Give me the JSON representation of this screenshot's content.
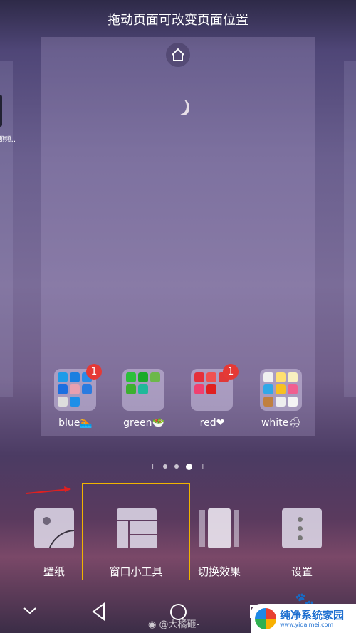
{
  "header": {
    "title": "拖动页面可改变页面位置"
  },
  "left_page": {
    "app_label": "视频.."
  },
  "folders": [
    {
      "label": "blue🏊",
      "badge": "1",
      "colors": [
        "#1e9be8",
        "#1a7fe0",
        "#2b8be8",
        "#1b6fe0",
        "#e8a0b0",
        "#2a7be0",
        "#ddd",
        "#1d8fe8"
      ]
    },
    {
      "label": "green🥗",
      "badge": "",
      "colors": [
        "#2bbf3a",
        "#1aaa2a",
        "#6cb84a",
        "#3cb030",
        "#1fb89a"
      ]
    },
    {
      "label": "red❤",
      "badge": "1",
      "colors": [
        "#e5303a",
        "#f05050",
        "#e03838",
        "#f04070",
        "#e02020"
      ]
    },
    {
      "label": "white🌨",
      "badge": "",
      "colors": [
        "#f0f0f0",
        "#ffe070",
        "#f8f0c0",
        "#30a8e8",
        "#f8c020",
        "#f06090",
        "#c08040",
        "#eeeeee",
        "#f4f4f4"
      ]
    }
  ],
  "page_indicator": {
    "count": 5,
    "active": 3
  },
  "options": [
    {
      "label": "壁纸"
    },
    {
      "label": "窗口小工具"
    },
    {
      "label": "切换效果"
    },
    {
      "label": "设置"
    }
  ],
  "highlight_color": "#f0b400",
  "arrow_color": "#e02020",
  "watermark": {
    "weibo": "@大橘砸-",
    "site_name": "纯净系统家园",
    "site_url": "www.yidaimei.com"
  }
}
